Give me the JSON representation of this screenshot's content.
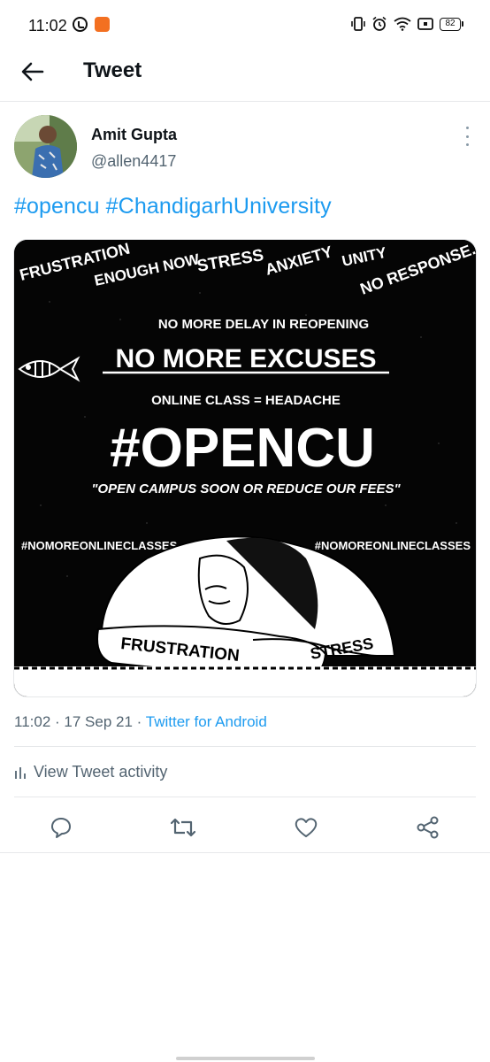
{
  "status_bar": {
    "time": "11:02",
    "battery": "82",
    "icons": [
      "whatsapp-icon",
      "notification-badge-icon",
      "vibrate-icon",
      "alarm-icon",
      "wifi-icon",
      "screen-record-icon",
      "battery-icon"
    ]
  },
  "app_bar": {
    "title": "Tweet",
    "back_icon": "arrow-left-icon"
  },
  "tweet": {
    "author": {
      "name": "Amit Gupta",
      "handle": "@allen4417"
    },
    "hashtags": [
      "#opencu",
      "#ChandigarhUniversity"
    ],
    "image": {
      "top_words": [
        "FRUSTRATION",
        "ENOUGH NOW",
        "STRESS",
        "ANXIETY",
        "UNITY",
        "NO RESPONSE."
      ],
      "line1": "NO MORE DELAY IN REOPENING",
      "line2": "NO MORE EXCUSES",
      "line3": "ONLINE CLASS = HEADACHE",
      "headline": "#OPENCU",
      "quote": "\"OPEN CAMPUS SOON OR REDUCE OUR FEES\"",
      "side_tag_left": "#NOMOREONLINECLASSES",
      "side_tag_right": "#NOMOREONLINECLASSES",
      "arm_left": "FRUSTRATION",
      "arm_right": "STRESS"
    },
    "meta": {
      "time": "11:02",
      "date": "17 Sep 21",
      "separator": "·",
      "source": "Twitter for Android"
    },
    "activity_label": "View Tweet activity",
    "actions": [
      "reply-icon",
      "retweet-icon",
      "like-icon",
      "share-icon"
    ]
  },
  "colors": {
    "accent": "#1d9bf0",
    "text_primary": "#0f1419",
    "text_secondary": "#536471",
    "divider": "#e6e8ea"
  }
}
